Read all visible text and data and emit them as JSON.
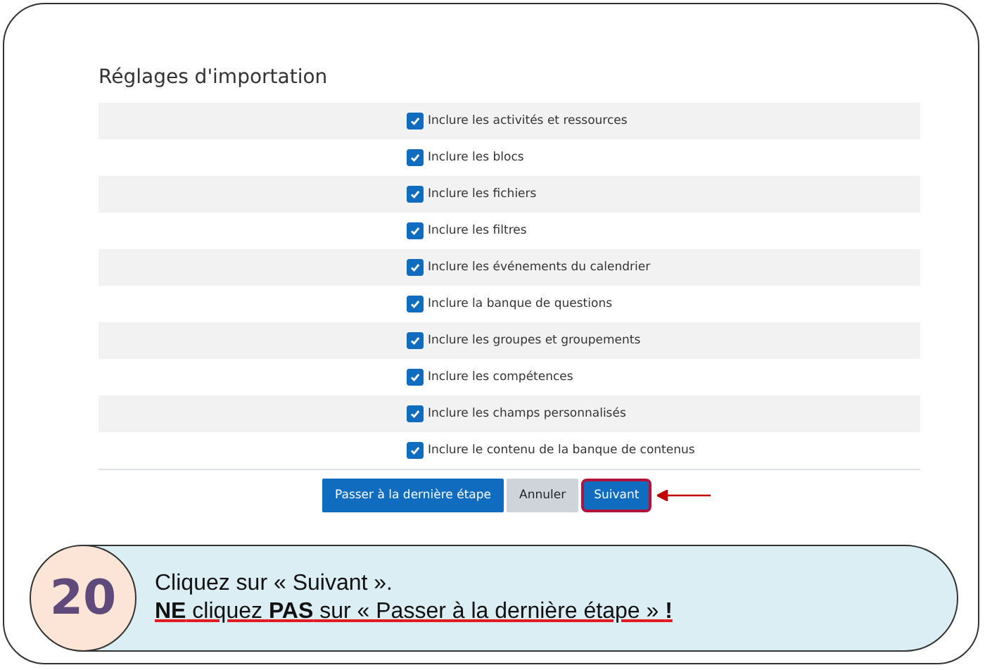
{
  "section": {
    "title": "Réglages d'importation"
  },
  "options": [
    {
      "label": "Inclure les activités et ressources",
      "checked": true
    },
    {
      "label": "Inclure les blocs",
      "checked": true
    },
    {
      "label": "Inclure les fichiers",
      "checked": true
    },
    {
      "label": "Inclure les filtres",
      "checked": true
    },
    {
      "label": "Inclure les événements du calendrier",
      "checked": true
    },
    {
      "label": "Inclure la banque de questions",
      "checked": true
    },
    {
      "label": "Inclure les groupes et groupements",
      "checked": true
    },
    {
      "label": "Inclure les compétences",
      "checked": true
    },
    {
      "label": "Inclure les champs personnalisés",
      "checked": true
    },
    {
      "label": "Inclure le contenu de la banque de contenus",
      "checked": true
    }
  ],
  "buttons": [
    {
      "label": "Passer à la dernière étape",
      "kind": "primary",
      "highlighted": false
    },
    {
      "label": "Annuler",
      "kind": "secondary",
      "highlighted": false
    },
    {
      "label": "Suivant",
      "kind": "primary",
      "highlighted": true
    }
  ],
  "step": {
    "number": "20",
    "lines": [
      "Cliquez sur « Suivant ».",
      "**NE** cliquez **PAS** sur « Passer à la dernière étape » **!**"
    ]
  }
}
